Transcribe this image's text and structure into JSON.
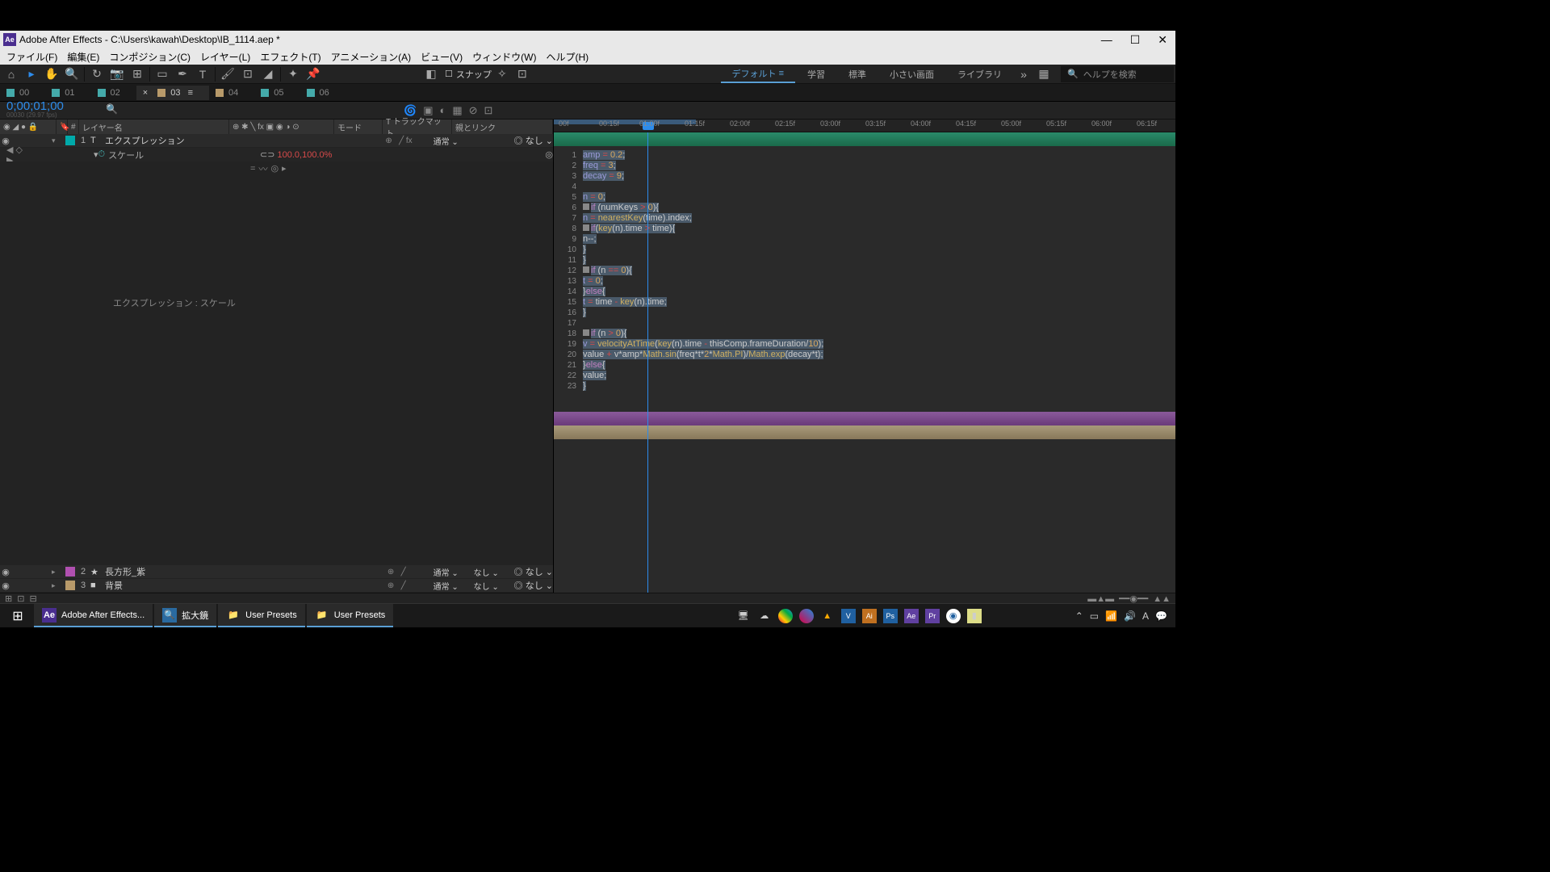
{
  "window": {
    "title": "Adobe After Effects - C:\\Users\\kawah\\Desktop\\IB_1114.aep *",
    "logo": "Ae"
  },
  "menu": [
    "ファイル(F)",
    "編集(E)",
    "コンポジション(C)",
    "レイヤー(L)",
    "エフェクト(T)",
    "アニメーション(A)",
    "ビュー(V)",
    "ウィンドウ(W)",
    "ヘルプ(H)"
  ],
  "tool_snap": "スナップ",
  "workspaces": [
    "デフォルト",
    "学習",
    "標準",
    "小さい画面",
    "ライブラリ"
  ],
  "workspace_active": 0,
  "help_search_placeholder": "ヘルプを検索",
  "comp_tabs": [
    {
      "label": "00",
      "active": false
    },
    {
      "label": "01",
      "active": false
    },
    {
      "label": "02",
      "active": false
    },
    {
      "label": "03",
      "active": true
    },
    {
      "label": "04",
      "active": false
    },
    {
      "label": "05",
      "active": false
    },
    {
      "label": "06",
      "active": false
    }
  ],
  "timecode": "0;00;01;00",
  "timecode_sub": "00030 (29.97 fps)",
  "layer_header": {
    "num": "#",
    "name": "レイヤー名",
    "mode": "モード",
    "track": "T  トラックマット",
    "parent": "親とリンク"
  },
  "layers": [
    {
      "num": "1",
      "name": "エクスプレッション",
      "type": "T",
      "mode": "通常",
      "trk": "",
      "parent": "なし",
      "class": "l1"
    },
    {
      "num": "2",
      "name": "長方形_紫",
      "type": "★",
      "mode": "通常",
      "trk": "なし",
      "parent": "なし",
      "class": "l2"
    },
    {
      "num": "3",
      "name": "背景",
      "type": "■",
      "mode": "通常",
      "trk": "なし",
      "parent": "なし",
      "class": "l3"
    }
  ],
  "prop": {
    "name": "スケール",
    "value": "100.0,100.0%"
  },
  "expr_label": "エクスプレッション : スケール",
  "ruler_ticks": [
    "00f",
    "00:15f",
    "01:00f",
    "01:15f",
    "02:00f",
    "02:15f",
    "03:00f",
    "03:15f",
    "04:00f",
    "04:15f",
    "05:00f",
    "05:15f",
    "06:00f",
    "06:15f"
  ],
  "code_lines": [
    "amp = 0.2;",
    "freq = 3;",
    "decay = 9;",
    "",
    "n = 0;",
    "if (numKeys > 0){",
    "n = nearestKey(time).index;",
    "if(key(n).time > time){",
    "n--;",
    "}",
    "}",
    "if (n == 0){",
    "t = 0;",
    "}else{",
    "t = time - key(n).time;",
    "}",
    "",
    "if (n > 0){",
    "v = velocityAtTime(key(n).time - thisComp.frameDuration/10);",
    "value + v*amp*Math.sin(freq*t*2*Math.PI)/Math.exp(decay*t);",
    "}else{",
    "value;",
    "}"
  ],
  "taskbar": {
    "items": [
      {
        "icon": "Ae",
        "label": "Adobe After Effects...",
        "iconbg": "#4a2e8f"
      },
      {
        "icon": "🔍",
        "label": "拡大鏡",
        "iconbg": "#2a6aa0"
      },
      {
        "icon": "📁",
        "label": "User Presets",
        "iconbg": "#c09040"
      },
      {
        "icon": "📁",
        "label": "User Presets",
        "iconbg": "#c09040"
      }
    ],
    "tray_apps": [
      "V",
      "Ai",
      "Ps",
      "Ae",
      "Pr"
    ]
  }
}
